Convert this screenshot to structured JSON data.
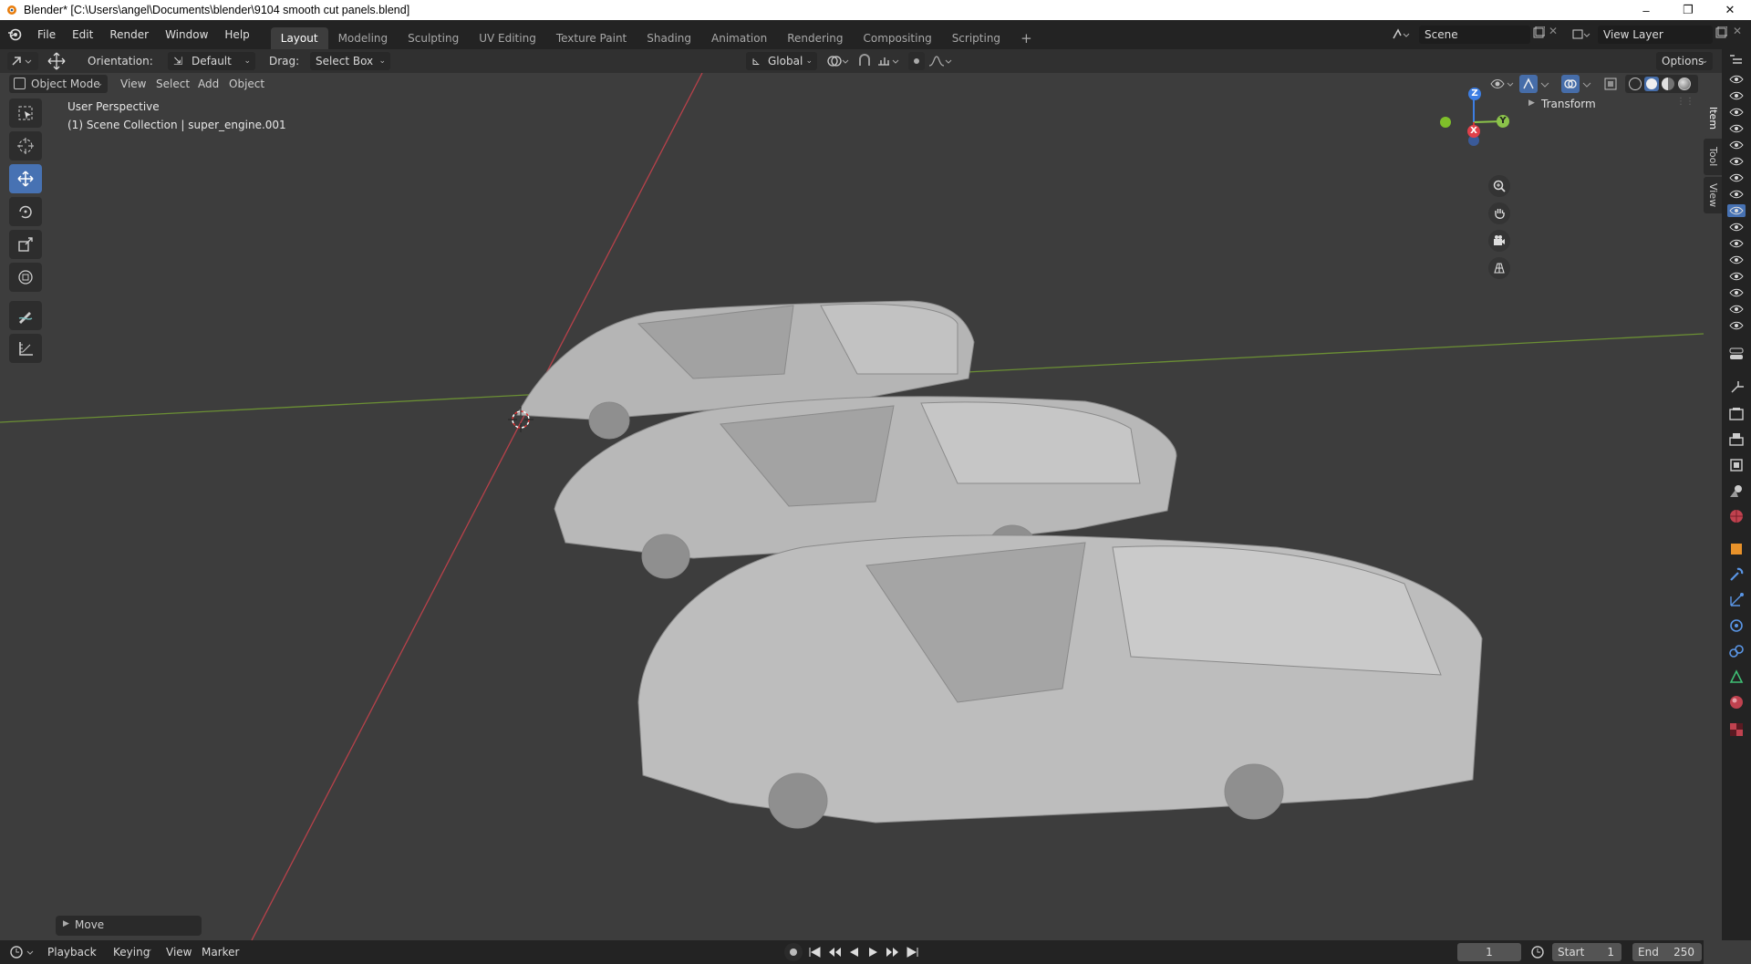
{
  "window": {
    "title": "Blender* [C:\\Users\\angel\\Documents\\blender\\9104 smooth cut panels.blend]",
    "controls": [
      "–",
      "❐",
      "✕"
    ]
  },
  "topbar": {
    "menus": [
      "File",
      "Edit",
      "Render",
      "Window",
      "Help"
    ],
    "workspaces": [
      "Layout",
      "Modeling",
      "Sculpting",
      "UV Editing",
      "Texture Paint",
      "Shading",
      "Animation",
      "Rendering",
      "Compositing",
      "Scripting"
    ],
    "active_workspace": "Layout",
    "add_tab": "+",
    "scene_value": "Scene",
    "view_layer_value": "View Layer"
  },
  "tool_header": {
    "orientation_label": "Orientation:",
    "orientation_value": "Default",
    "drag_label": "Drag:",
    "drag_value": "Select Box",
    "transform_orientation": "Global",
    "options_label": "Options"
  },
  "view_header": {
    "mode": "Object Mode",
    "menus": [
      "View",
      "Select",
      "Add",
      "Object"
    ]
  },
  "viewport": {
    "perspective_label": "User Perspective",
    "collection_label": "(1) Scene Collection | super_engine.001",
    "gizmo_axes": {
      "z": "Z",
      "y": "Y",
      "x": "X"
    }
  },
  "npanel": {
    "tabs": [
      "Item",
      "Tool",
      "View"
    ],
    "active_tab": "Item",
    "transform_label": "Transform"
  },
  "last_operator": {
    "label": "Move"
  },
  "timeline": {
    "menus": [
      "Playback",
      "Keying",
      "View",
      "Marker"
    ],
    "current_frame": "1",
    "start_label": "Start",
    "start_value": "1",
    "end_label": "End",
    "end_value": "250"
  },
  "colors": {
    "accent": "#4772b3",
    "axis_x": "#e0404a",
    "axis_y": "#8bc34a",
    "axis_z": "#3d7ee3",
    "background": "#3d3d3d"
  }
}
